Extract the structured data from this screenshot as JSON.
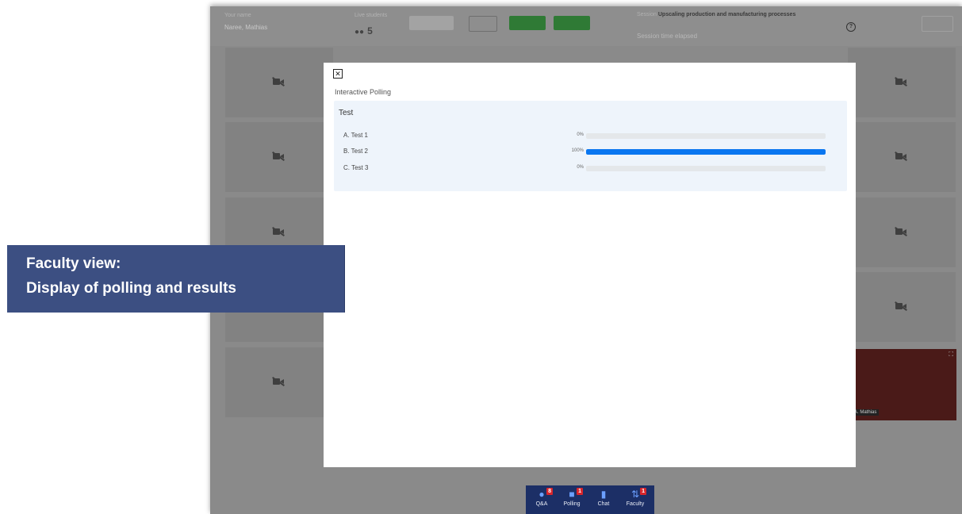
{
  "topbar": {
    "name_label": "Your name",
    "name_value": "Naree, Mathias",
    "people_label": "Live students",
    "people_count": "5",
    "session_label": "Session",
    "session_title": "Upscaling production and manufacturing processes",
    "session_time": "Session time elapsed"
  },
  "modal": {
    "title": "Interactive Polling",
    "question": "Test",
    "options": [
      {
        "label": "A. Test 1",
        "percent_text": "0%",
        "percent": 0
      },
      {
        "label": "B. Test 2",
        "percent_text": "100%",
        "percent": 100
      },
      {
        "label": "C. Test 3",
        "percent_text": "0%",
        "percent": 0
      }
    ]
  },
  "participant": {
    "name": "A. Mathias"
  },
  "bottom_nav": [
    {
      "label": "Q&A",
      "badge": "8",
      "icon": "qa-icon"
    },
    {
      "label": "Polling",
      "badge": "1",
      "icon": "polling-icon"
    },
    {
      "label": "Chat",
      "badge": "",
      "icon": "chat-icon"
    },
    {
      "label": "Faculty",
      "badge": "1",
      "icon": "faculty-icon"
    }
  ],
  "annotation": {
    "line1": "Faculty view:",
    "line2": "Display of polling and results"
  },
  "colors": {
    "accent": "#0a76f0",
    "callout_bg": "#3c4f82",
    "badge": "#d8262c",
    "nav_bg": "#1c2f66"
  }
}
